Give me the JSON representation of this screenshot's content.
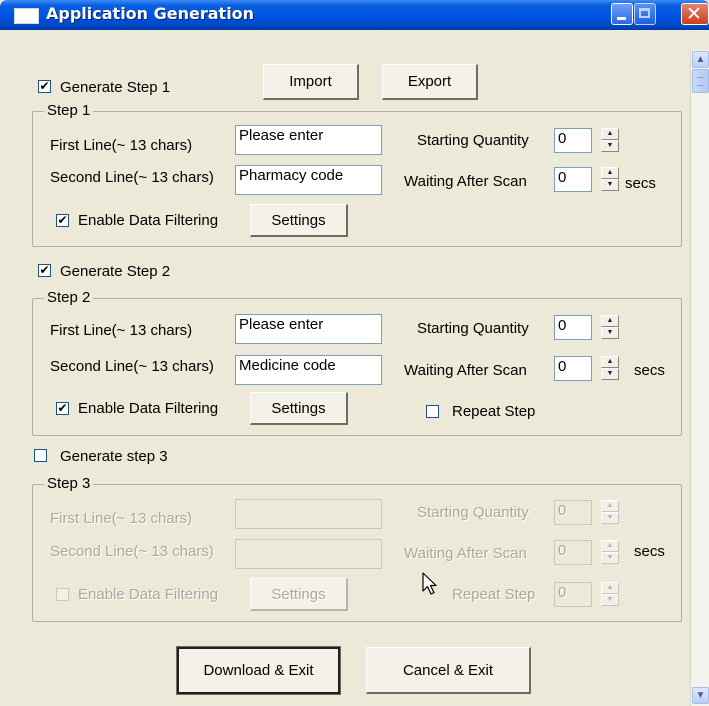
{
  "window": {
    "title": "Application Generation"
  },
  "top": {
    "generate_step1_label": "Generate Step 1",
    "generate_step1_checked": true,
    "import_label": "Import",
    "export_label": "Export"
  },
  "step1": {
    "group_title": "Step 1",
    "first_line_label": "First Line(~ 13 chars)",
    "first_line_value": "Please enter",
    "second_line_label": "Second Line(~ 13 chars)",
    "second_line_value": "Pharmacy code",
    "starting_quantity_label": "Starting Quantity",
    "starting_quantity_value": "0",
    "waiting_after_scan_label": "Waiting After Scan",
    "waiting_after_scan_value": "0",
    "secs_label": "secs",
    "enable_filtering_label": "Enable Data Filtering",
    "enable_filtering_checked": true,
    "settings_label": "Settings"
  },
  "generate_step2": {
    "label": "Generate Step 2",
    "checked": true
  },
  "step2": {
    "group_title": "Step 2",
    "first_line_label": "First Line(~ 13 chars)",
    "first_line_value": "Please enter",
    "second_line_label": "Second Line(~ 13 chars)",
    "second_line_value": "Medicine code",
    "starting_quantity_label": "Starting Quantity",
    "starting_quantity_value": "0",
    "waiting_after_scan_label": "Waiting After Scan",
    "waiting_after_scan_value": "0",
    "secs_label": "secs",
    "enable_filtering_label": "Enable Data Filtering",
    "enable_filtering_checked": true,
    "settings_label": "Settings",
    "repeat_step_label": "Repeat Step",
    "repeat_step_checked": false
  },
  "generate_step3": {
    "label": "Generate step 3",
    "checked": false
  },
  "step3": {
    "group_title": "Step 3",
    "first_line_label": "First Line(~ 13 chars)",
    "first_line_value": "",
    "second_line_label": "Second Line(~ 13 chars)",
    "second_line_value": "",
    "starting_quantity_label": "Starting Quantity",
    "starting_quantity_value": "0",
    "waiting_after_scan_label": "Waiting After Scan",
    "waiting_after_scan_value": "0",
    "secs_label": "secs",
    "enable_filtering_label": "Enable Data Filtering",
    "enable_filtering_checked": false,
    "settings_label": "Settings",
    "repeat_step_label": "Repeat Step",
    "repeat_step_value": "0"
  },
  "footer": {
    "download_label": "Download & Exit",
    "cancel_label": "Cancel & Exit"
  },
  "icons": {
    "check_glyph": "✔",
    "window_icon": "app-window-icon",
    "cursor": "mouse-pointer-icon"
  },
  "colors": {
    "titlebar": "#0054e3",
    "dialog_background": "#ece9d8",
    "disabled_text": "#aca899",
    "close_button": "#c8401e"
  }
}
